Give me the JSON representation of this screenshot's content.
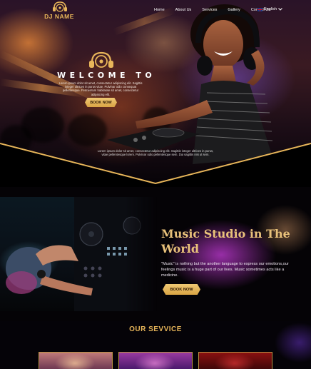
{
  "brand": {
    "name": "DJ NAME",
    "accent": "#e8b65a"
  },
  "nav": {
    "items": [
      {
        "label": "Home",
        "active": true
      },
      {
        "label": "About Us"
      },
      {
        "label": "Services"
      },
      {
        "label": "Gallery"
      },
      {
        "label": "Contact Us"
      }
    ],
    "language": {
      "label": "English",
      "icon": "uk-flag-icon"
    }
  },
  "hero": {
    "title": "WELCOME TO",
    "text": "Lorem ipsum dolor sit amet, consectetur adipiscing elit. Sagittis integer ultrices in purus vitae. Pulvinar odio consequat pellentesque. Fermentum habitasse sit amet, consectetur adipiscing elit.",
    "button": "BOOK NOW",
    "bottom_text": "Lorem ipsum dolor sit amet, consectetur adipiscing elit. Sagittis integer ultrices in purus, vitae pellentesque lorem. Pulvinar odio pellentesque sem. Dui sagittis nisi ut sem."
  },
  "studio": {
    "title": "Music Studio in The World",
    "text": "\"Music\" is nothing but the another language to express our emotions,our feelings music is a huge part of our lives. Music sometimes acts like a medicine.",
    "button": "BOOK NOW"
  },
  "services": {
    "title": "OUR SEVVICE"
  }
}
